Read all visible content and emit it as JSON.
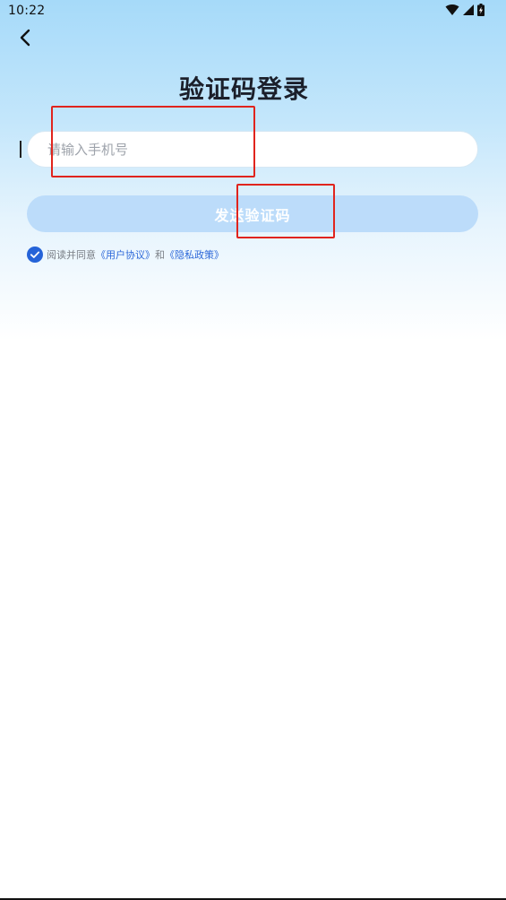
{
  "status_bar": {
    "time": "10:22",
    "icons": [
      "wifi-icon",
      "signal-icon",
      "battery-icon"
    ]
  },
  "nav": {
    "back_icon": "chevron-left-icon"
  },
  "login": {
    "title": "验证码登录",
    "phone_placeholder": "请输入手机号",
    "phone_value": "",
    "send_code_label": "发送验证码"
  },
  "agreement": {
    "checked": true,
    "prefix": "阅读并同意",
    "user_agreement": "《用户协议》",
    "and": "和",
    "privacy_policy": "《隐私政策》"
  },
  "colors": {
    "accent": "#2e69d9",
    "button_disabled": "#bcdcfa",
    "highlight_box": "#e0241d",
    "title": "#1b1f2a"
  }
}
